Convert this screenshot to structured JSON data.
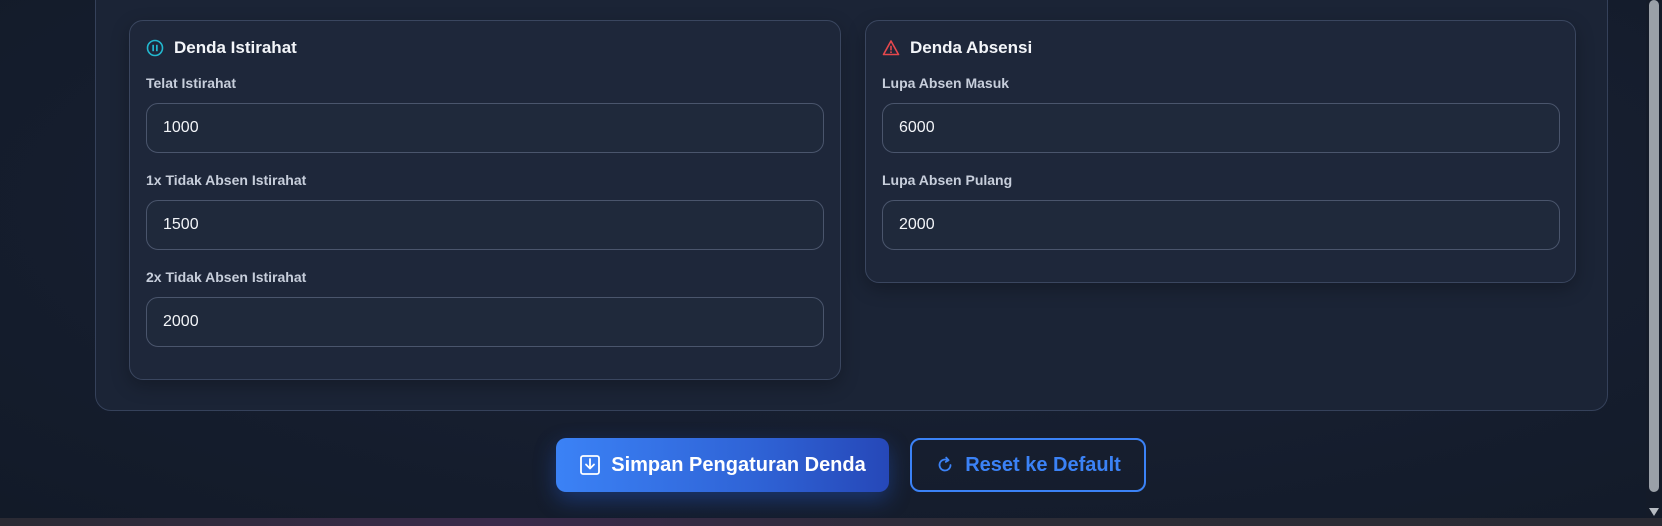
{
  "cards": {
    "break_penalty": {
      "title": "Denda Istirahat",
      "icon": "pause-circle-icon",
      "icon_color": "#22b8cf",
      "fields": [
        {
          "label": "Telat Istirahat",
          "value": "1000"
        },
        {
          "label": "1x Tidak Absen Istirahat",
          "value": "1500"
        },
        {
          "label": "2x Tidak Absen Istirahat",
          "value": "2000"
        }
      ]
    },
    "attendance_penalty": {
      "title": "Denda Absensi",
      "icon": "warning-triangle-icon",
      "icon_color": "#e5484d",
      "fields": [
        {
          "label": "Lupa Absen Masuk",
          "value": "6000"
        },
        {
          "label": "Lupa Absen Pulang",
          "value": "2000"
        }
      ]
    }
  },
  "actions": {
    "save_label": "Simpan Pengaturan Denda",
    "save_icon": "download-icon",
    "reset_label": "Reset ke Default",
    "reset_icon": "refresh-icon"
  },
  "colors": {
    "accent": "#3b82f6",
    "background": "#161e2f",
    "card": "#1e273a"
  }
}
